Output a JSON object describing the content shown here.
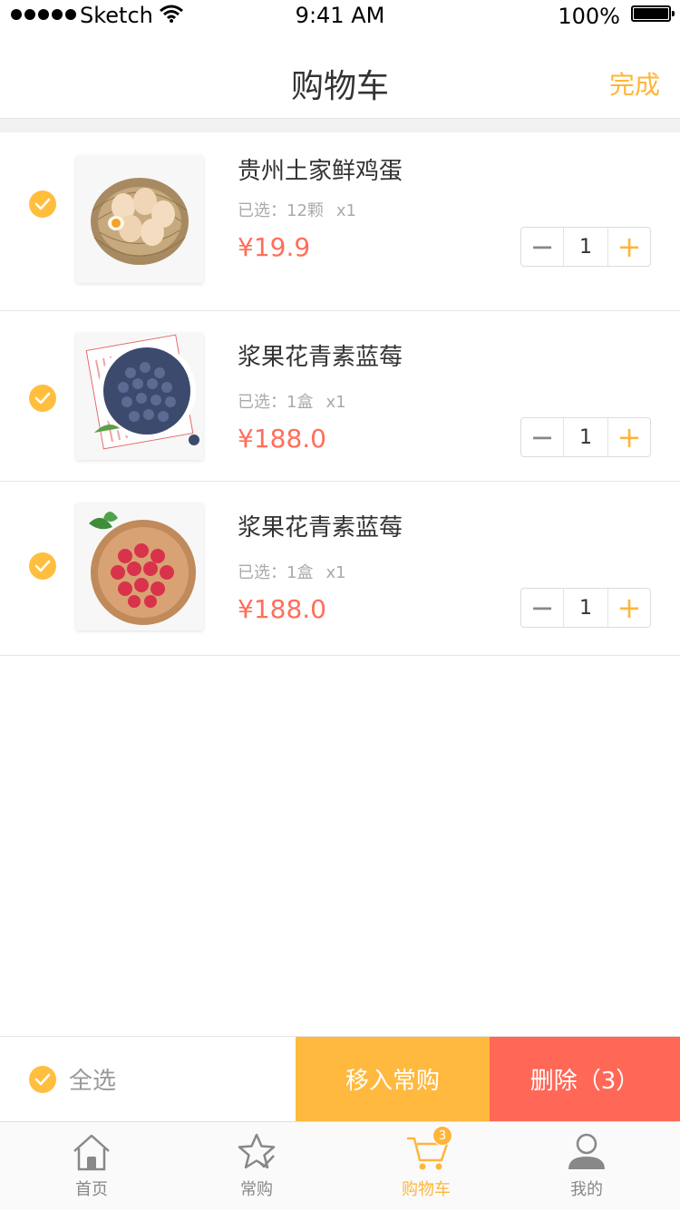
{
  "status_bar": {
    "carrier": "Sketch",
    "time": "9:41 AM",
    "battery": "100%"
  },
  "nav": {
    "title": "购物车",
    "done_label": "完成"
  },
  "items": [
    {
      "title": "贵州土家鲜鸡蛋",
      "spec_label": "已选：12颗",
      "spec_qty": "x1",
      "price": "¥19.9",
      "quantity": "1",
      "image": "egg-basket-image",
      "checked": true
    },
    {
      "title": "浆果花青素蓝莓",
      "spec_label": "已选：1盒",
      "spec_qty": "x1",
      "price": "¥188.0",
      "quantity": "1",
      "image": "blueberry-bowl-image",
      "checked": true
    },
    {
      "title": "浆果花青素蓝莓",
      "spec_label": "已选：1盒",
      "spec_qty": "x1",
      "price": "¥188.0",
      "quantity": "1",
      "image": "raspberry-bowl-image",
      "checked": true
    }
  ],
  "action_bar": {
    "select_all_label": "全选",
    "favorite_label": "移入常购",
    "delete_label": "删除（3）"
  },
  "tabs": [
    {
      "label": "首页",
      "icon": "home-icon"
    },
    {
      "label": "常购",
      "icon": "star-icon"
    },
    {
      "label": "购物车",
      "icon": "cart-icon",
      "badge": "3",
      "active": true
    },
    {
      "label": "我的",
      "icon": "user-icon"
    }
  ],
  "colors": {
    "accent": "#FFB53A",
    "price": "#FF6E5A",
    "delete": "#FF6757"
  }
}
